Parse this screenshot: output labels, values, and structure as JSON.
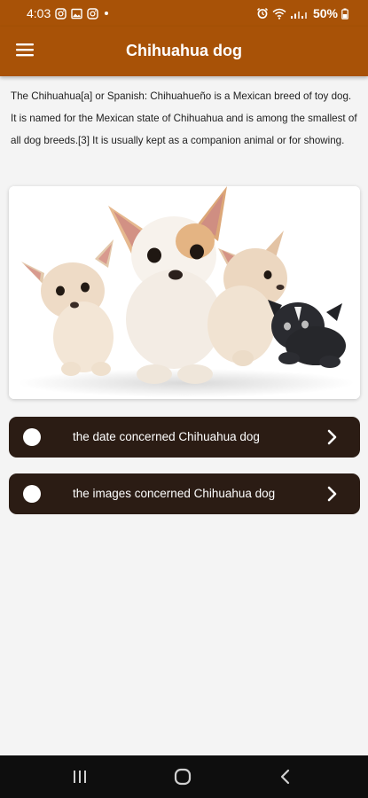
{
  "status_bar": {
    "time": "4:03",
    "battery": "50%"
  },
  "app_bar": {
    "title": "Chihuahua dog"
  },
  "intro": {
    "text": "The Chihuahua[a] or Spanish: Chihuahueño is a Mexican breed of toy dog. It is named for the Mexican state of Chihuahua and is among the smallest of all dog breeds.[3] It is usually kept as a companion animal or for showing."
  },
  "buttons": [
    {
      "label": "the date concerned Chihuahua dog"
    },
    {
      "label": "the images concerned Chihuahua dog"
    }
  ],
  "colors": {
    "primary": "#a85207",
    "button_bg": "#2b1c14",
    "background": "#f4f4f4",
    "nav_bar": "#0e0e0e"
  },
  "icons": [
    "instagram-icon",
    "gallery-icon",
    "instagram-icon",
    "alarm-icon",
    "wifi-icon",
    "signal-icon",
    "battery-icon",
    "menu-icon",
    "chevron-right-icon",
    "recent-apps-icon",
    "home-icon",
    "back-icon"
  ]
}
